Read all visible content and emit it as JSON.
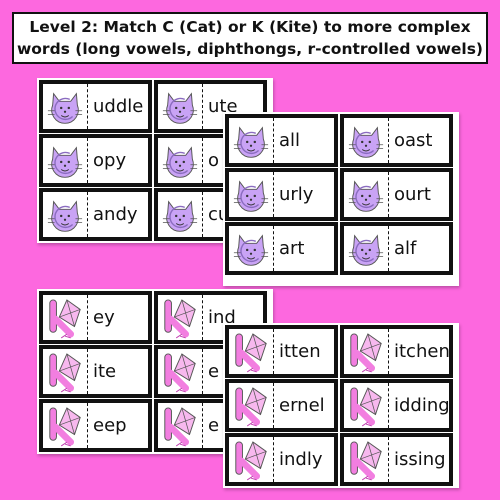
{
  "title": {
    "line1": "Level 2: Match C (Cat) or K (Kite) to more complex",
    "line2": "words (long vowels, diphthongs, r-controlled vowels)"
  },
  "colors": {
    "background": "#fd68df",
    "cat": "#c9a3f5",
    "kite": "#f27ee0"
  },
  "sheets": [
    {
      "icon": "cat-icon",
      "cards": [
        "uddle",
        "ute",
        "opy",
        "o",
        "andy",
        "cu"
      ]
    },
    {
      "icon": "cat-icon",
      "cards": [
        "all",
        "oast",
        "urly",
        "ourt",
        "art",
        "alf"
      ]
    },
    {
      "icon": "kite-icon",
      "cards": [
        "ey",
        "ind",
        "ite",
        "e",
        "eep",
        "e"
      ]
    },
    {
      "icon": "kite-icon",
      "cards": [
        "itten",
        "itchen",
        "ernel",
        "idding",
        "indly",
        "issing"
      ]
    }
  ]
}
